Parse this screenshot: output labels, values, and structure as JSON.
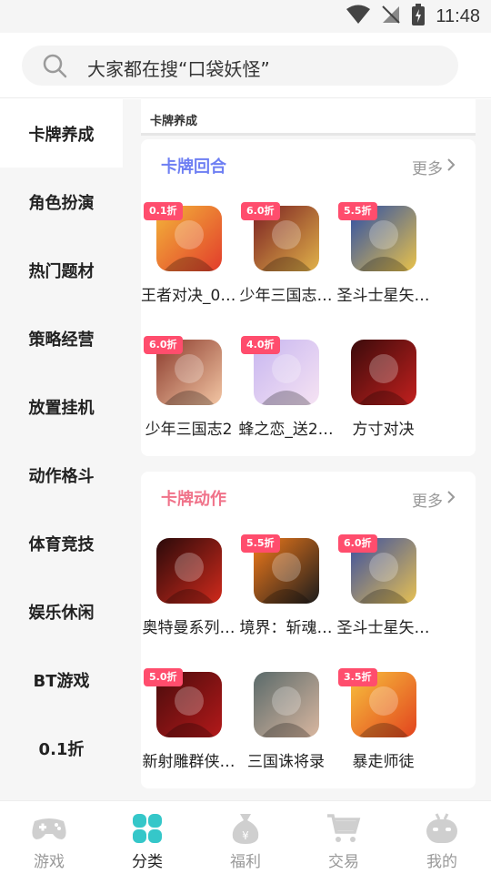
{
  "status_bar": {
    "time": "11:48"
  },
  "search": {
    "text": "大家都在搜“口袋妖怪”"
  },
  "sidebar": {
    "items": [
      {
        "label": "卡牌养成",
        "active": true
      },
      {
        "label": "角色扮演"
      },
      {
        "label": "热门题材"
      },
      {
        "label": "策略经营"
      },
      {
        "label": "放置挂机"
      },
      {
        "label": "动作格斗"
      },
      {
        "label": "体育竞技"
      },
      {
        "label": "娱乐休闲"
      },
      {
        "label": "BT游戏"
      },
      {
        "label": "0.1折"
      }
    ]
  },
  "section_header": "卡牌养成",
  "more_label": "更多",
  "cards": [
    {
      "title": "卡牌回合",
      "title_color": "#6e7ff3",
      "games": [
        {
          "name": "王者对决_0.…",
          "badge": "0.1折",
          "palette": [
            "#f3b53a",
            "#e23c2b"
          ]
        },
        {
          "name": "少年三国志…",
          "badge": "6.0折",
          "palette": [
            "#7a1f22",
            "#e1b24a"
          ]
        },
        {
          "name": "圣斗士星矢…",
          "badge": "5.5折",
          "palette": [
            "#2b4ea8",
            "#e9c24a"
          ]
        },
        {
          "name": "少年三国志2",
          "badge": "6.0折",
          "palette": [
            "#8a3a2c",
            "#f3c6a4"
          ]
        },
        {
          "name": "蜂之恋_送2…",
          "badge": "4.0折",
          "palette": [
            "#c7b6f0",
            "#f6e3f3"
          ]
        },
        {
          "name": "方寸对决",
          "badge": "",
          "palette": [
            "#3b0b0b",
            "#c2201e"
          ]
        }
      ]
    },
    {
      "title": "卡牌动作",
      "title_color": "#f0738a",
      "games": [
        {
          "name": "奥特曼系列…",
          "badge": "",
          "palette": [
            "#2a0a0a",
            "#d02a1c"
          ]
        },
        {
          "name": "境界：斩魂…",
          "badge": "5.5折",
          "palette": [
            "#f17a1b",
            "#1c1c1c"
          ]
        },
        {
          "name": "圣斗士星矢…",
          "badge": "6.0折",
          "palette": [
            "#3a4fa0",
            "#e6c053"
          ]
        },
        {
          "name": "新射雕群侠…",
          "badge": "5.0折",
          "palette": [
            "#4a0c0c",
            "#b3191a"
          ]
        },
        {
          "name": "三国诛将录",
          "badge": "",
          "palette": [
            "#5a6a6a",
            "#d9b7a0"
          ]
        },
        {
          "name": "暴走师徒",
          "badge": "3.5折",
          "palette": [
            "#f7c13d",
            "#e2431e"
          ]
        }
      ]
    }
  ],
  "tabbar": {
    "items": [
      {
        "label": "游戏",
        "icon": "gamepad-icon"
      },
      {
        "label": "分类",
        "icon": "category-icon",
        "active": true
      },
      {
        "label": "福利",
        "icon": "money-bag-icon"
      },
      {
        "label": "交易",
        "icon": "cart-icon"
      },
      {
        "label": "我的",
        "icon": "robot-face-icon"
      }
    ],
    "active_color": "#35c7c9",
    "inactive_color": "#cfcfcf"
  }
}
